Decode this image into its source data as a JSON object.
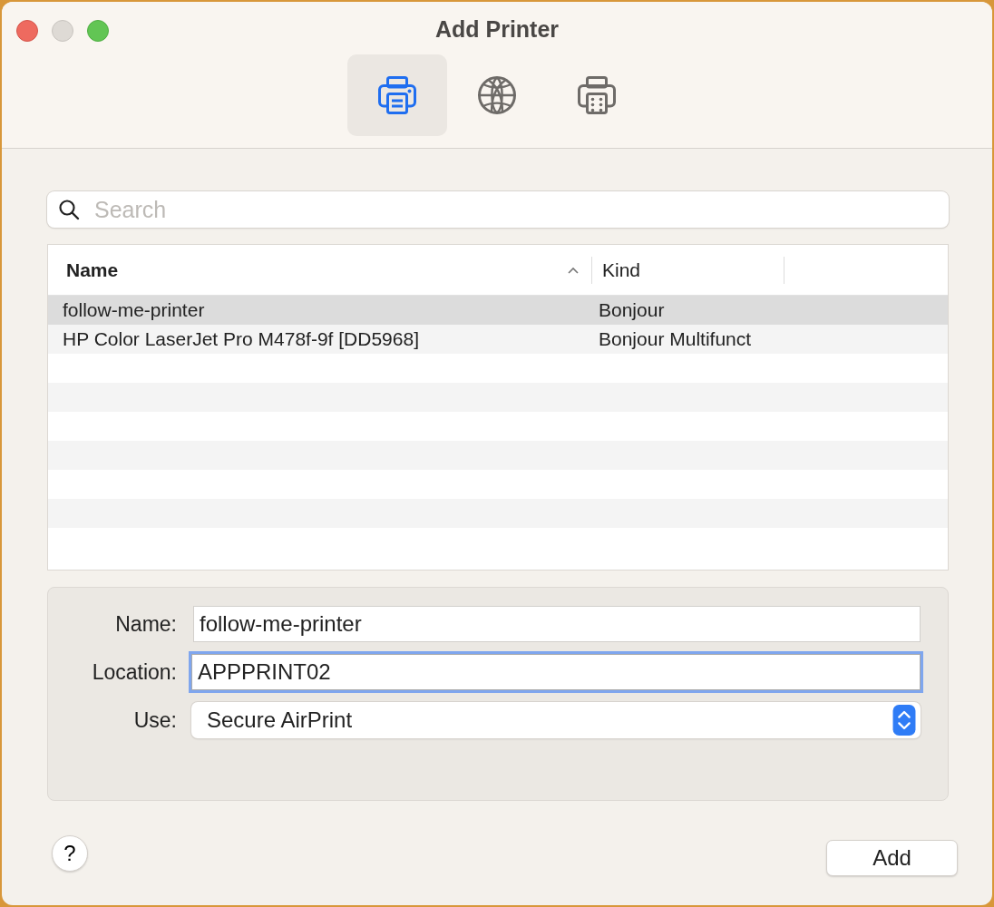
{
  "window": {
    "title": "Add Printer"
  },
  "tabs": [
    {
      "kind": "printer",
      "selected": true
    },
    {
      "kind": "globe",
      "selected": false
    },
    {
      "kind": "fax",
      "selected": false
    }
  ],
  "search": {
    "placeholder": "Search"
  },
  "table": {
    "columns": [
      {
        "label": "Name",
        "sorted": true
      },
      {
        "label": "Kind",
        "sorted": false
      }
    ],
    "rows": [
      {
        "cells": [
          "follow-me-printer",
          "Bonjour"
        ],
        "selected": true
      },
      {
        "cells": [
          "HP Color LaserJet Pro M478f-9f [DD5968]",
          "Bonjour Multifunct"
        ],
        "selected": false
      }
    ]
  },
  "form": [
    {
      "kind": "text",
      "label": "Name:",
      "value": "follow-me-printer",
      "focused": false
    },
    {
      "kind": "text",
      "label": "Location:",
      "value": "APPPRINT02",
      "focused": true
    },
    {
      "kind": "select",
      "label": "Use:",
      "value": "Secure AirPrint"
    }
  ],
  "buttons": {
    "help": "?",
    "add": "Add"
  }
}
